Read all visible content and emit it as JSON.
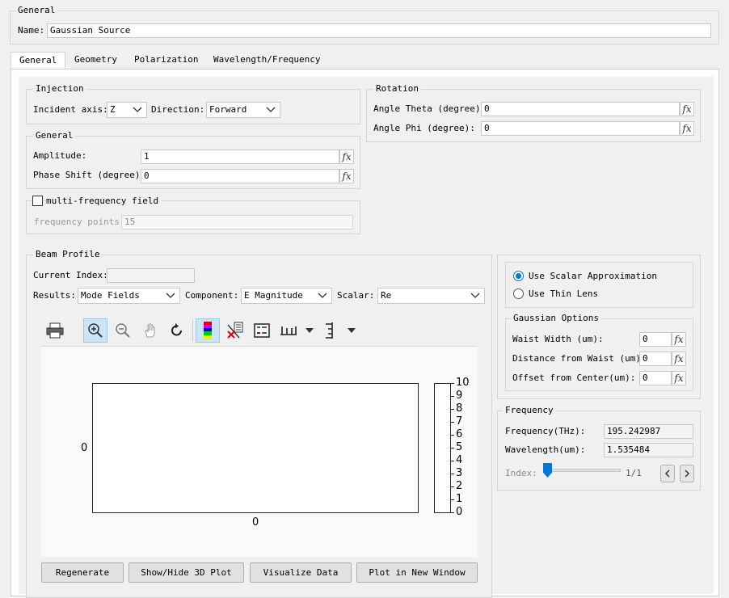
{
  "general_top": {
    "title": "General",
    "name_label": "Name:",
    "name_value": "Gaussian Source"
  },
  "tabs": [
    {
      "label": "General"
    },
    {
      "label": "Geometry"
    },
    {
      "label": "Polarization"
    },
    {
      "label": "Wavelength/Frequency"
    }
  ],
  "injection": {
    "title": "Injection",
    "incident_axis_label": "Incident axis:",
    "incident_axis_value": "Z",
    "direction_label": "Direction:",
    "direction_value": "Forward"
  },
  "rotation": {
    "title": "Rotation",
    "theta_label": "Angle Theta (degree):",
    "theta_value": "0",
    "phi_label": "Angle Phi (degree):",
    "phi_value": "0"
  },
  "general_inner": {
    "title": "General",
    "amplitude_label": "Amplitude:",
    "amplitude_value": "1",
    "phase_label": "Phase Shift (degree):",
    "phase_value": "0"
  },
  "multi_freq": {
    "title": "multi-frequency field",
    "checked": false,
    "points_label": "frequency points:",
    "points_value": "15"
  },
  "beam_profile": {
    "title": "Beam Profile",
    "current_index_label": "Current Index:",
    "current_index_value": "",
    "results_label": "Results:",
    "results_value": "Mode Fields",
    "component_label": "Component:",
    "component_value": "E Magnitude",
    "scalar_label": "Scalar:",
    "scalar_value": "Re"
  },
  "plot": {
    "y_label": "0",
    "x_label": "0",
    "colorbar_ticks": [
      "10",
      "9",
      "8",
      "7",
      "6",
      "5",
      "4",
      "3",
      "2",
      "1",
      "0"
    ]
  },
  "buttons": {
    "regenerate": "Regenerate",
    "show_hide_3d": "Show/Hide 3D Plot",
    "visualize": "Visualize Data",
    "plot_new_window": "Plot in New Window"
  },
  "approx": {
    "scalar_label": "Use Scalar Approximation",
    "thin_lens_label": "Use Thin Lens",
    "selected": "scalar"
  },
  "gaussian_options": {
    "title": "Gaussian Options",
    "waist_label": "Waist Width (um):",
    "waist_value": "0",
    "distance_label": "Distance from Waist (um):",
    "distance_value": "0",
    "offset_label": "Offset from Center(um):",
    "offset_value": "0"
  },
  "frequency": {
    "title": "Frequency",
    "freq_label": "Frequency(THz):",
    "freq_value": "195.242987",
    "wavelength_label": "Wavelength(um):",
    "wavelength_value": "1.535484",
    "index_label": "Index:",
    "index_value": "1/1",
    "slider_fraction": 0
  },
  "fx_label": "fx",
  "colors": {
    "accent": "#0078d7",
    "toolbar_active": "#cce4f7"
  }
}
